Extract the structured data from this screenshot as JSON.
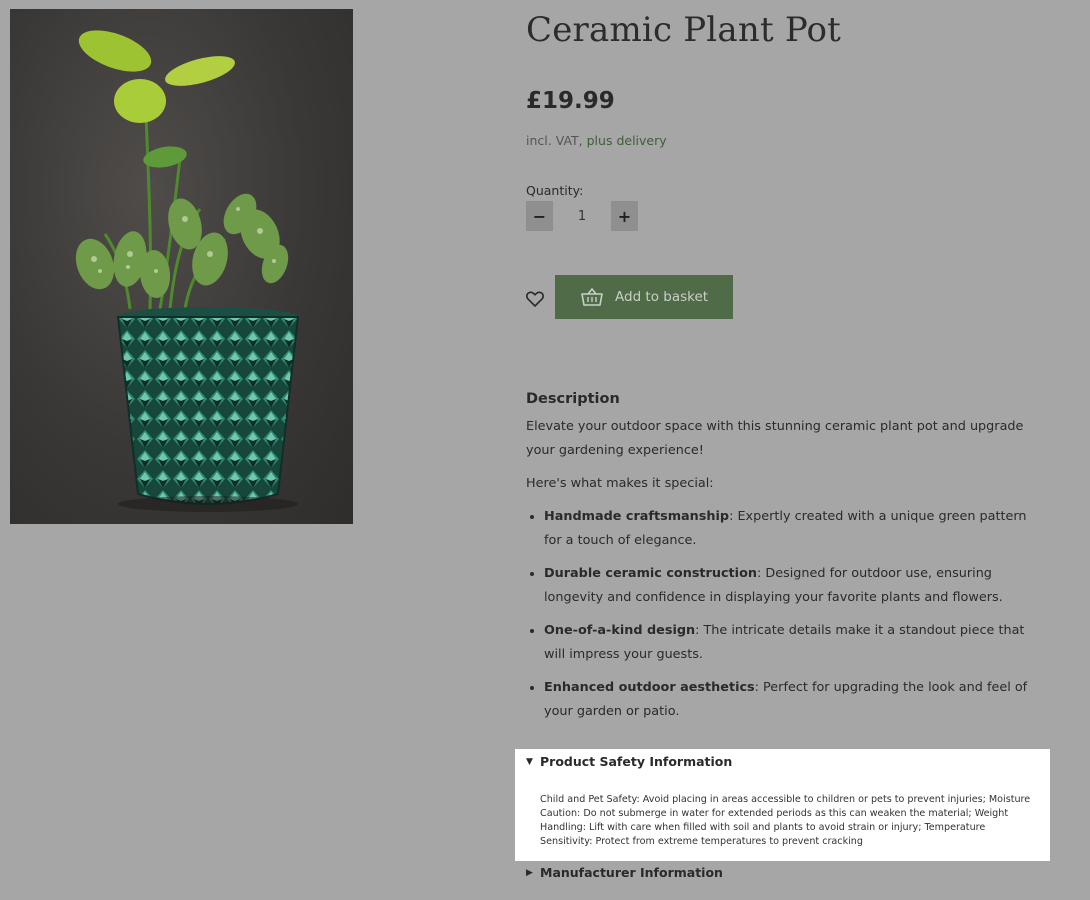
{
  "product": {
    "title": "Ceramic Plant Pot",
    "price": "£19.99",
    "vat_text": "incl. VAT,",
    "delivery_link": "plus delivery",
    "quantity_label": "Quantity:",
    "quantity_value": "1",
    "decrement_label": "−",
    "increment_label": "+",
    "add_to_basket_label": "Add to basket"
  },
  "description": {
    "heading": "Description",
    "intro": "Elevate your outdoor space with this stunning ceramic plant pot and upgrade your gardening experience!",
    "lead": "Here's what makes it special:",
    "features": [
      {
        "name": "Handmade craftsmanship",
        "text": ": Expertly created with a unique green pattern for a touch of elegance."
      },
      {
        "name": "Durable ceramic construction",
        "text": ": Designed for outdoor use, ensuring longevity and confidence in displaying your favorite plants and flowers."
      },
      {
        "name": "One-of-a-kind design",
        "text": ": The intricate details make it a standout piece that will impress your guests."
      },
      {
        "name": "Enhanced outdoor aesthetics",
        "text": ": Perfect for upgrading the look and feel of your garden or patio."
      }
    ]
  },
  "safety": {
    "heading": "Product Safety Information",
    "text": "Child and Pet Safety: Avoid placing in areas accessible to children or pets to prevent injuries; Moisture Caution: Do not submerge in water for extended periods as this can weaken the material; Weight Handling: Lift with care when filled with soil and plants to avoid strain or injury; Temperature Sensitivity: Protect from extreme temperatures to prevent cracking"
  },
  "manufacturer": {
    "heading": "Manufacturer Information"
  },
  "colors": {
    "overlay": "#a6a6a6",
    "button": "#4f6b48",
    "pot": "#1f5a4a"
  }
}
